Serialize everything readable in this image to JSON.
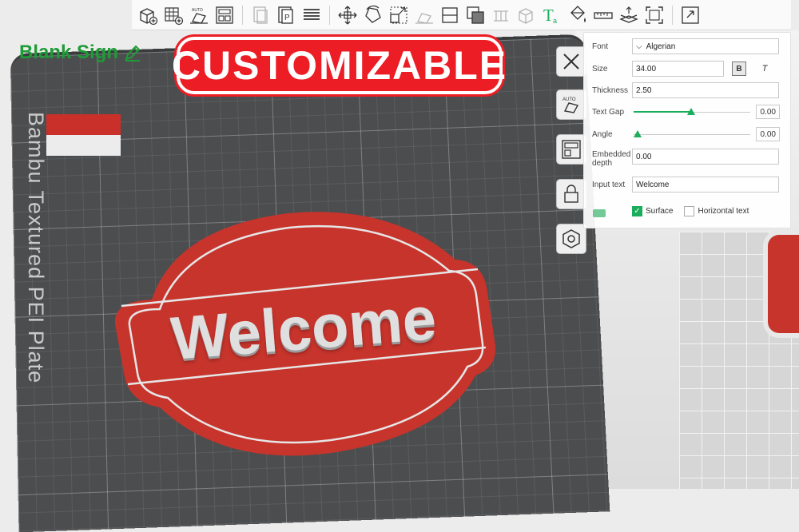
{
  "toolbar": {
    "icons": [
      "add-cube-icon",
      "add-plate-icon",
      "auto-orient-icon",
      "arrange-icon",
      "copy-icon",
      "paste-icon",
      "layers-icon",
      "move-icon",
      "rotate-icon",
      "scale-icon",
      "lay-on-face-icon",
      "cut-icon",
      "boolean-icon",
      "support-paint-icon",
      "measure-cube-icon",
      "text-tool-icon",
      "paint-bucket-icon",
      "measure-ruler-icon",
      "assembly-icon",
      "fit-view-icon",
      "explode-icon"
    ],
    "auto_label": "AUTO"
  },
  "overlay": {
    "blank_sign": "Blank Sign",
    "title": "CUSTOMIZABLE"
  },
  "plate": {
    "label": "Bambu Textured PEI Plate"
  },
  "sign": {
    "text": "Welcome",
    "color": "#c7342c"
  },
  "text_panel": {
    "font_label": "Font",
    "font_value": "Algerian",
    "size_label": "Size",
    "size_value": "34.00",
    "bold_label": "B",
    "italic_label": "T",
    "thickness_label": "Thickness",
    "thickness_value": "2.50",
    "gap_label": "Text Gap",
    "gap_value": "0.00",
    "angle_label": "Angle",
    "angle_value": "0.00",
    "depth_label": "Embedded depth",
    "depth_value": "0.00",
    "input_label": "Input text",
    "input_value": "Welcome",
    "surface_label": "Surface",
    "surface_checked": true,
    "horizontal_label": "Horizontal text",
    "horizontal_checked": false
  },
  "colors": {
    "accent_green": "#1aae5c",
    "title_red": "#ec1d24",
    "blank_sign_green": "#1f9b38"
  }
}
